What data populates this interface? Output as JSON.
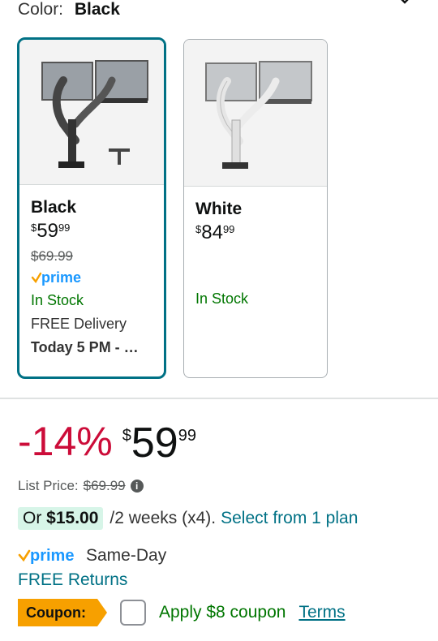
{
  "color_label": "Color:",
  "color_value": "Black",
  "options": [
    {
      "name": "Black",
      "price_currency": "$",
      "price_whole": "59",
      "price_fraction": "99",
      "list_price": "$69.99",
      "prime": "prime",
      "stock": "In Stock",
      "delivery": "FREE Delivery",
      "delivery_time": "Today 5 PM - …"
    },
    {
      "name": "White",
      "price_currency": "$",
      "price_whole": "84",
      "price_fraction": "99",
      "stock": "In Stock"
    }
  ],
  "main": {
    "discount": "-14%",
    "currency": "$",
    "whole": "59",
    "fraction": "99",
    "list_price_label": "List Price:",
    "list_price_value": "$69.99",
    "info_icon": "i"
  },
  "plan": {
    "or": "Or",
    "amount": "$15.00",
    "schedule": "/2 weeks (x4).",
    "link": "Select from 1 plan"
  },
  "shipping": {
    "prime": "prime",
    "same_day": "Same-Day",
    "returns": "FREE Returns"
  },
  "coupon": {
    "tag": "Coupon:",
    "apply": "Apply $8 coupon",
    "terms": "Terms"
  },
  "colors": {
    "selected_border": "#007185",
    "discount": "#cc0c39",
    "stock": "#007600",
    "link": "#007185",
    "coupon": "#f7a000",
    "prime": "#1a98ff"
  }
}
